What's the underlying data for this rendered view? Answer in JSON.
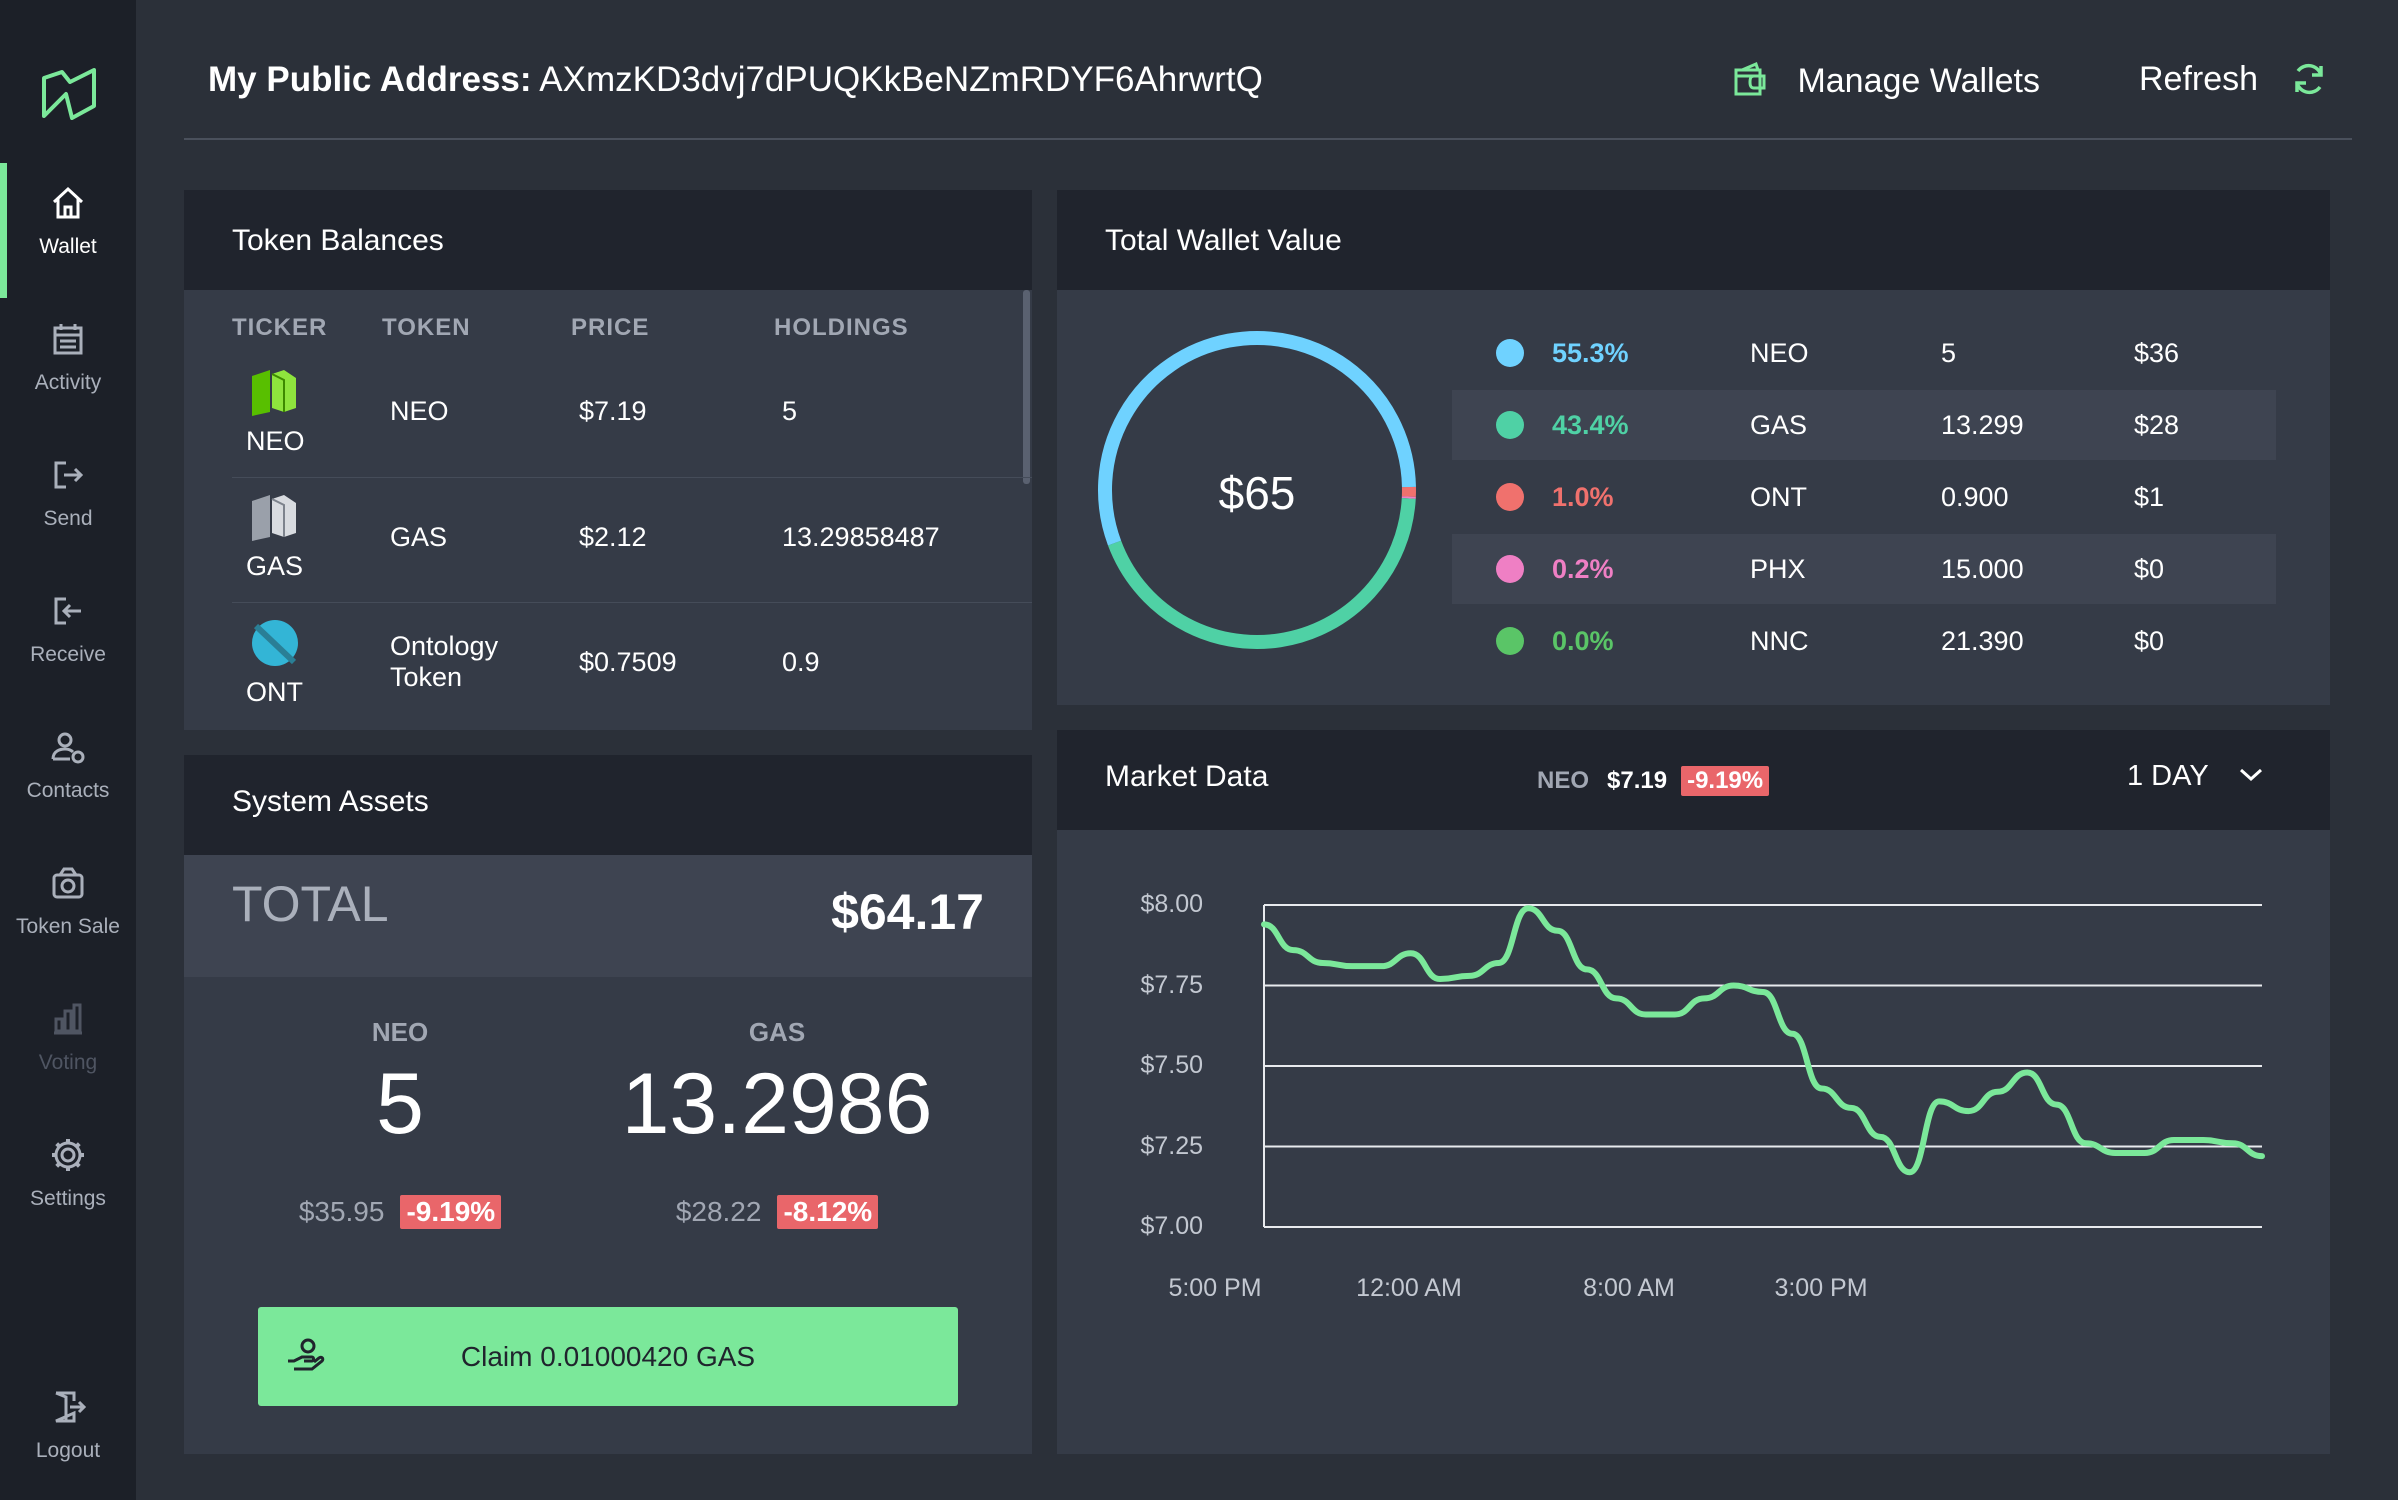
{
  "window": {
    "controls": [
      "close",
      "minimize",
      "maximize"
    ]
  },
  "sidebar": {
    "logo_icon": "neon-logo-icon",
    "items": [
      {
        "label": "Wallet",
        "icon": "home-icon",
        "active": true
      },
      {
        "label": "Activity",
        "icon": "calendar-icon"
      },
      {
        "label": "Send",
        "icon": "send-icon"
      },
      {
        "label": "Receive",
        "icon": "receive-icon"
      },
      {
        "label": "Contacts",
        "icon": "contacts-icon"
      },
      {
        "label": "Token Sale",
        "icon": "token-sale-icon"
      },
      {
        "label": "Voting",
        "icon": "voting-icon",
        "disabled": true
      },
      {
        "label": "Settings",
        "icon": "gear-icon"
      }
    ],
    "logout": {
      "label": "Logout",
      "icon": "logout-icon"
    }
  },
  "header": {
    "address_label": "My Public Address:",
    "address": "AXmzKD3dvj7dPUQKkBeNZmRDYF6AhrwrtQ",
    "manage_wallets": "Manage Wallets",
    "refresh": "Refresh"
  },
  "token_balances": {
    "title": "Token Balances",
    "columns": [
      "TICKER",
      "TOKEN",
      "PRICE",
      "HOLDINGS"
    ],
    "rows": [
      {
        "ticker": "NEO",
        "token": "NEO",
        "token_line2": "",
        "price": "$7.19",
        "holdings": "5",
        "icon": "neo-token-icon",
        "color": "#58bf00"
      },
      {
        "ticker": "GAS",
        "token": "GAS",
        "token_line2": "",
        "price": "$2.12",
        "holdings": "13.29858487",
        "icon": "gas-token-icon",
        "color": "#b9bec7"
      },
      {
        "ticker": "ONT",
        "token": "Ontology",
        "token_line2": "Token",
        "price": "$0.7509",
        "holdings": "0.9",
        "icon": "ont-token-icon",
        "color": "#33b5d6"
      }
    ]
  },
  "system_assets": {
    "title": "System Assets",
    "total_label": "TOTAL",
    "total_value": "$64.17",
    "neo": {
      "label": "NEO",
      "amount": "5",
      "value": "$35.95",
      "change": "-9.19%"
    },
    "gas": {
      "label": "GAS",
      "amount": "13.2986",
      "value": "$28.22",
      "change": "-8.12%"
    },
    "claim_button": "Claim 0.01000420 GAS"
  },
  "total_wallet_value": {
    "title": "Total Wallet Value",
    "center_value": "$65",
    "legend": [
      {
        "pct": "55.3%",
        "symbol": "NEO",
        "amount": "5",
        "value": "$36",
        "color": "#6fd2ff"
      },
      {
        "pct": "43.4%",
        "symbol": "GAS",
        "amount": "13.299",
        "value": "$28",
        "color": "#4fd1a5"
      },
      {
        "pct": "1.0%",
        "symbol": "ONT",
        "amount": "0.900",
        "value": "$1",
        "color": "#f0716d"
      },
      {
        "pct": "0.2%",
        "symbol": "PHX",
        "amount": "15.000",
        "value": "$0",
        "color": "#ef7fc4"
      },
      {
        "pct": "0.0%",
        "symbol": "NNC",
        "amount": "21.390",
        "value": "$0",
        "color": "#5ac567"
      }
    ],
    "slices": [
      55.3,
      43.4,
      1.0,
      0.2,
      0.0
    ]
  },
  "market_data": {
    "title": "Market Data",
    "symbol": "NEO",
    "price": "$7.19",
    "change": "-9.19%",
    "range": "1 DAY"
  },
  "chart_data": {
    "type": "line",
    "ylim": [
      7.0,
      8.0
    ],
    "yticks": [
      "$8.00",
      "$7.75",
      "$7.50",
      "$7.25",
      "$7.00"
    ],
    "xticks": [
      "5:00 PM",
      "12:00 AM",
      "8:00 AM",
      "3:00 PM"
    ],
    "line_color": "#7be89a",
    "series": [
      {
        "values": [
          7.94,
          7.86,
          7.82,
          7.81,
          7.81,
          7.85,
          7.77,
          7.78,
          7.82,
          7.99,
          7.92,
          7.8,
          7.71,
          7.66,
          7.66,
          7.71,
          7.75,
          7.73,
          7.6,
          7.43,
          7.37,
          7.28,
          7.17,
          7.39,
          7.36,
          7.42,
          7.48,
          7.38,
          7.26,
          7.23,
          7.23,
          7.27,
          7.27,
          7.26,
          7.22
        ]
      }
    ]
  },
  "colors": {
    "accent": "#7be89a",
    "negative": "#e9666a"
  }
}
